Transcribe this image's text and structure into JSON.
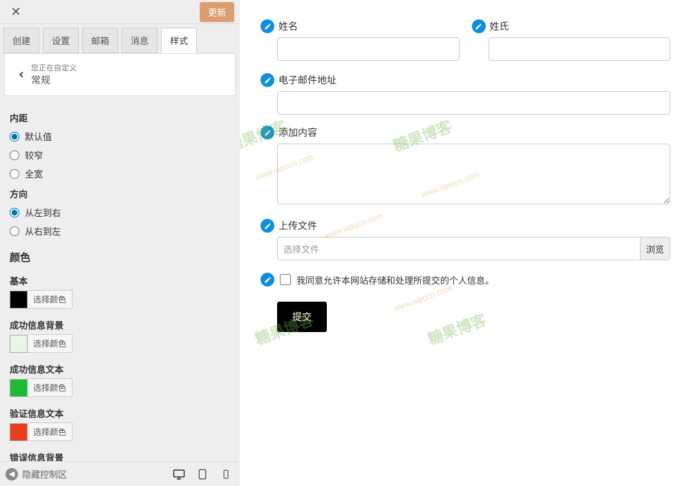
{
  "header": {
    "update_label": "更新"
  },
  "tabs": [
    "创建",
    "设置",
    "邮箱",
    "消息",
    "样式"
  ],
  "panel": {
    "sub": "您正在自定义",
    "title": "常规"
  },
  "sections": {
    "padding": {
      "title": "内距",
      "options": [
        "默认值",
        "较窄",
        "全宽"
      ],
      "selected": 0
    },
    "direction": {
      "title": "方向",
      "options": [
        "从左到右",
        "从右到左"
      ],
      "selected": 0
    },
    "colors": {
      "title": "颜色",
      "pick_label": "选择颜色",
      "items": [
        {
          "label": "基本",
          "color": "#000000"
        },
        {
          "label": "成功信息背景",
          "color": "#e8f5e8"
        },
        {
          "label": "成功信息文本",
          "color": "#1fb934"
        },
        {
          "label": "验证信息文本",
          "color": "#e83e1f"
        },
        {
          "label": "错误信息背景",
          "color": "#ffffff"
        }
      ]
    }
  },
  "footer": {
    "hide_label": "隐藏控制区"
  },
  "preview": {
    "first_name_label": "姓名",
    "last_name_label": "姓氏",
    "email_label": "电子邮件地址",
    "content_label": "添加内容",
    "upload_label": "上传文件",
    "file_placeholder": "选择文件",
    "browse_label": "浏览",
    "consent_label": "我同意允许本网站存储和处理所提交的个人信息。",
    "submit_label": "提交"
  },
  "watermarks": {
    "brand": "糖果博客",
    "url": "www.wpocn.com"
  }
}
